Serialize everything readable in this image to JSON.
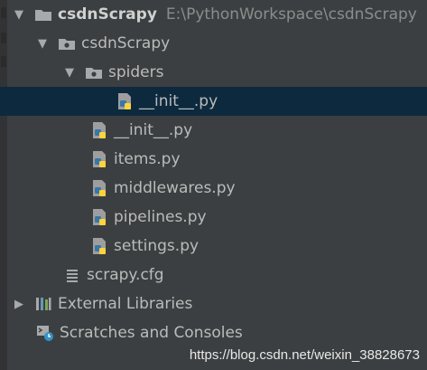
{
  "tree": {
    "root": {
      "label": "csdnScrapy",
      "path": "E:\\PythonWorkspace\\csdnScrapy",
      "icon": "folder-icon",
      "expanded": true
    },
    "package": {
      "label": "csdnScrapy",
      "icon": "package-folder-icon",
      "expanded": true
    },
    "spiders": {
      "label": "spiders",
      "icon": "package-folder-icon",
      "expanded": true
    },
    "spiders_init": {
      "label": "__init__.py",
      "icon": "python-file-icon",
      "selected": true
    },
    "files": [
      {
        "label": "__init__.py",
        "icon": "python-file-icon"
      },
      {
        "label": "items.py",
        "icon": "python-file-icon"
      },
      {
        "label": "middlewares.py",
        "icon": "python-file-icon"
      },
      {
        "label": "pipelines.py",
        "icon": "python-file-icon"
      },
      {
        "label": "settings.py",
        "icon": "python-file-icon"
      }
    ],
    "config": {
      "label": "scrapy.cfg",
      "icon": "config-file-icon"
    },
    "external_libraries": {
      "label": "External Libraries",
      "icon": "libraries-icon",
      "expanded": false
    },
    "scratches": {
      "label": "Scratches and Consoles",
      "icon": "scratches-icon"
    }
  },
  "watermark": "https://blog.csdn.net/weixin_38828673",
  "colors": {
    "background": "#3c3f41",
    "selection": "#0d293e",
    "text": "#bbbbbb",
    "path": "#8c8c8c",
    "folder": "#a7a9ab",
    "python_blue": "#3776ab",
    "python_yellow": "#ffd43b"
  }
}
